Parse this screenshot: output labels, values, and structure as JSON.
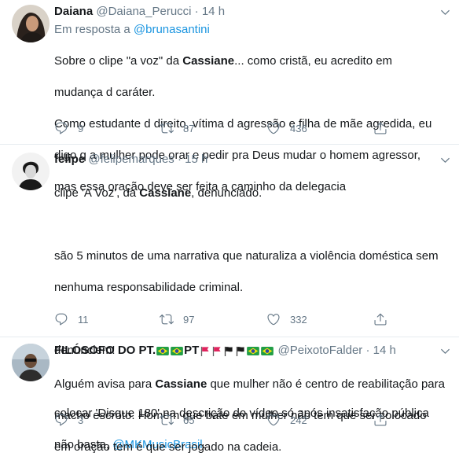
{
  "tweets": [
    {
      "name": "Daiana",
      "handle": "@Daiana_Perucci",
      "dot": "·",
      "time": "14 h",
      "reply_prefix": "Em resposta a ",
      "reply_handle": "@brunasantini",
      "lines": [
        {
          "pre": "Sobre o clipe \"a voz\" da ",
          "bold": "Cassiane",
          "post": "...  como cristã,  eu acredito em"
        },
        {
          "pre": "mudança d caráter.",
          "bold": "",
          "post": ""
        },
        {
          "pre": "Como estudante d direito, vítima d agressão e filha de mãe agredida, eu",
          "bold": "",
          "post": ""
        },
        {
          "pre": "digo q a mulher pode orar e pedir pra Deus mudar o homem agressor,",
          "bold": "",
          "post": ""
        },
        {
          "pre": "mas essa oração deve ser feita a caminho da delegacia",
          "bold": "",
          "post": ""
        }
      ],
      "replies": "9",
      "retweets": "87",
      "likes": "436"
    },
    {
      "name": "felipe",
      "handle": "@felipemarques",
      "dot": "·",
      "time": "15 h",
      "p1_pre": "clipe 'A Voz', da ",
      "p1_bold": "Cassiane",
      "p1_post": ", denunciado.",
      "p2_l1": "são 5 minutos de uma narrativa que naturaliza a violência doméstica sem",
      "p2_l2": "nenhuma responsabilidade criminal.",
      "p3": "denunciem!",
      "p4_l1": "colocar 'Disque 180' na descrição do vídeo só após insatisfação pública",
      "p4_l2_pre": "não basta, ",
      "p4_mention": "@MKMusicBrasil",
      "p4_l2_post": ".",
      "replies": "11",
      "retweets": "97",
      "likes": "332"
    },
    {
      "name_prefix": "FILÓSOFO DO PT.",
      "name_mid": "PT",
      "handle": "@PeixotoFalder",
      "dot": "·",
      "time": "14 h",
      "l1_pre": "Alguém avisa para ",
      "l1_bold": "Cassiane",
      "l1_post": " que mulher não é centro de reabilitação para",
      "l2": "macho escroto. Homem que bate em mulher não tem que ser colocado",
      "l3": "em oração tem é que ser jogado na cadeia.",
      "replies": "3",
      "retweets": "65",
      "likes": "242"
    }
  ],
  "colors": {
    "link": "#1b95e0",
    "muted": "#657786",
    "divider": "#e6ecf0"
  },
  "icons": [
    "reply-icon",
    "retweet-icon",
    "like-icon",
    "share-icon",
    "chevron-down-icon",
    "brazil-flag-icon",
    "red-flag-icon",
    "black-flag-icon"
  ]
}
